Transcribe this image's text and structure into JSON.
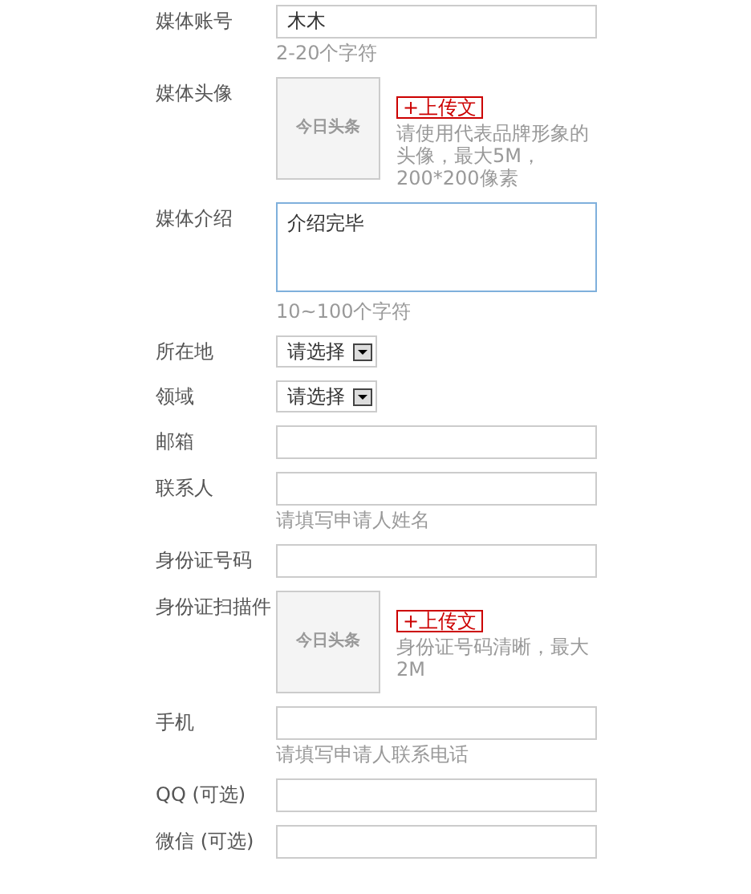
{
  "form": {
    "rows": [
      {
        "kind": "text",
        "label": "媒体账号",
        "value": "木木",
        "hint": "2-20个字符"
      },
      {
        "kind": "upload",
        "label": "媒体头像",
        "image_text": "今日头条",
        "button": "+上传文",
        "hint": "请使用代表品牌形象的头像，最大5M，200*200像素"
      },
      {
        "kind": "textarea",
        "label": "媒体介绍",
        "value": "介绍完毕",
        "hint": "10~100个字符"
      },
      {
        "kind": "select",
        "label": "所在地",
        "value": "请选择"
      },
      {
        "kind": "select",
        "label": "领域",
        "value": "请选择"
      },
      {
        "kind": "text",
        "label": "邮箱",
        "value": ""
      },
      {
        "kind": "text",
        "label": "联系人",
        "value": "",
        "hint": "请填写申请人姓名"
      },
      {
        "kind": "text",
        "label": "身份证号码",
        "value": ""
      },
      {
        "kind": "upload",
        "label": "身份证扫描件",
        "image_text": "今日头条",
        "button": "+上传文",
        "hint": "身份证号码清晰，最大2M"
      },
      {
        "kind": "text",
        "label": "手机",
        "value": "",
        "hint": "请填写申请人联系电话"
      },
      {
        "kind": "text",
        "label": "QQ (可选)",
        "value": ""
      },
      {
        "kind": "text",
        "label": "微信 (可选)",
        "value": ""
      }
    ]
  }
}
